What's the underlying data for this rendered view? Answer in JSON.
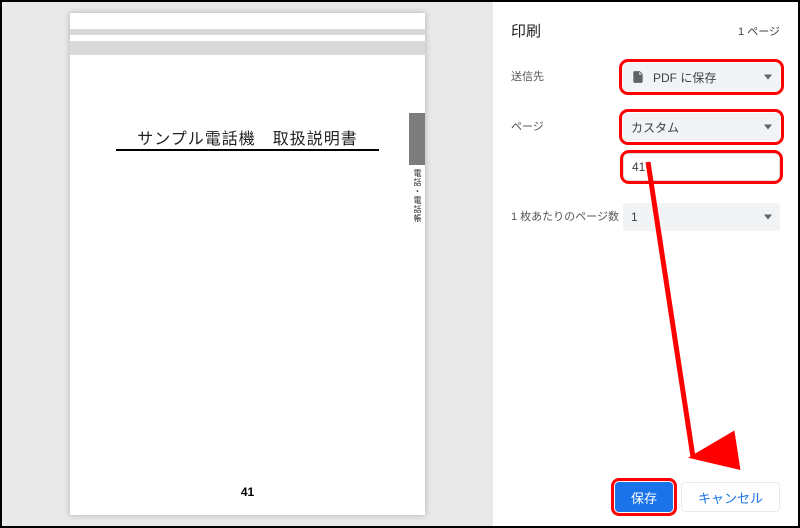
{
  "preview": {
    "doc_title": "サンプル電話機　取扱説明書",
    "side_tab_label": "電話・電話帳",
    "page_number": "41"
  },
  "panel": {
    "title": "印刷",
    "sheet_count_label": "1 ページ",
    "destination": {
      "label": "送信先",
      "value": "PDF に保存",
      "icon": "pdf-icon"
    },
    "pages": {
      "label": "ページ",
      "mode_value": "カスタム",
      "range_value": "41"
    },
    "pages_per_sheet": {
      "label": "1 枚あたりのページ数",
      "value": "1"
    },
    "save_label": "保存",
    "cancel_label": "キャンセル"
  }
}
